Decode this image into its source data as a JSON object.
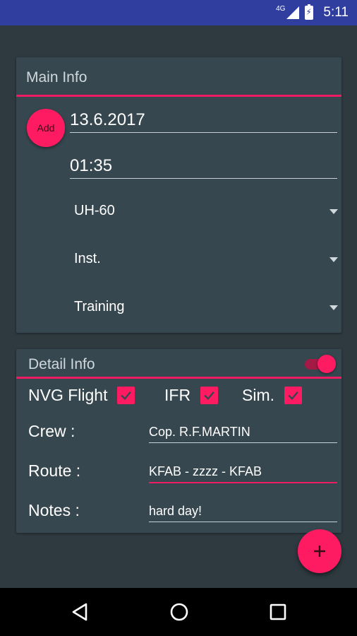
{
  "status_bar": {
    "network": "4G",
    "time": "5:11"
  },
  "main_info": {
    "title": "Main Info",
    "add_label": "Add",
    "date": "13.6.2017",
    "time": "01:35",
    "aircraft": "UH-60",
    "flight_rule": "Inst.",
    "mission": "Training"
  },
  "detail_info": {
    "title": "Detail Info",
    "toggle_on": true,
    "checks": [
      {
        "label": "NVG Flight",
        "checked": true
      },
      {
        "label": "IFR",
        "checked": true
      },
      {
        "label": "Sim.",
        "checked": true
      }
    ],
    "crew_label": "Crew :",
    "crew_value": "Cop. R.F.MARTIN",
    "route_label": "Route :",
    "route_value": "KFAB - zzzz - KFAB",
    "notes_label": "Notes :",
    "notes_value": "hard day!"
  },
  "fab": {
    "icon": "plus-icon"
  },
  "nav": {
    "back_icon": "back-icon",
    "home_icon": "home-icon",
    "recents_icon": "recents-icon"
  },
  "colors": {
    "accent": "#ff1b62",
    "background": "#2e3a40",
    "card": "#37474f",
    "status_bar": "#303f9f"
  }
}
